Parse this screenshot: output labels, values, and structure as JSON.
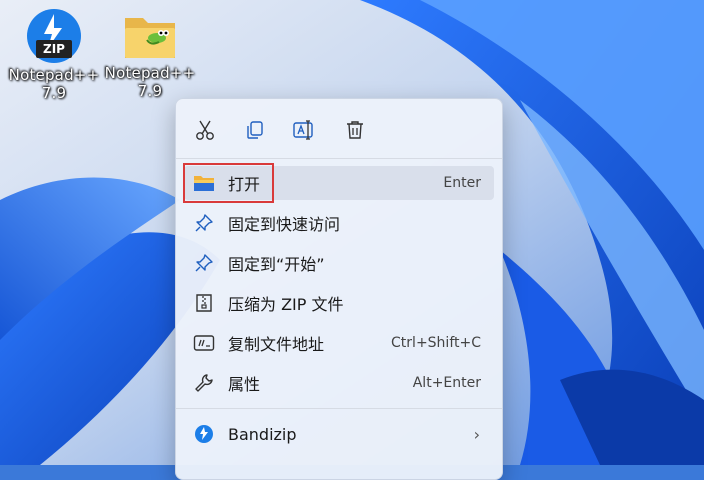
{
  "desktop": {
    "icons": [
      {
        "label": "Notepad++\n7.9",
        "icon": "zip-archive-icon",
        "badge": "ZIP"
      },
      {
        "label": "Notepad++\n7.9",
        "icon": "folder-icon"
      }
    ]
  },
  "context_menu": {
    "toolbar": [
      "cut-icon",
      "copy-icon",
      "rename-icon",
      "delete-icon"
    ],
    "items": [
      {
        "label": "打开",
        "shortcut": "Enter",
        "icon": "folder-open-icon"
      },
      {
        "label": "固定到快速访问",
        "shortcut": "",
        "icon": "pin-icon"
      },
      {
        "label": "固定到“开始”",
        "shortcut": "",
        "icon": "pin-icon"
      },
      {
        "label": "压缩为 ZIP 文件",
        "shortcut": "",
        "icon": "zip-file-icon"
      },
      {
        "label": "复制文件地址",
        "shortcut": "Ctrl+Shift+C",
        "icon": "copy-path-icon"
      },
      {
        "label": "属性",
        "shortcut": "Alt+Enter",
        "icon": "wrench-icon"
      },
      {
        "label": "Bandizip",
        "shortcut": "",
        "icon": "bandizip-icon",
        "submenu": true
      }
    ]
  },
  "colors": {
    "highlight_border": "#d93a3a",
    "accent": "#2b6fd6"
  }
}
